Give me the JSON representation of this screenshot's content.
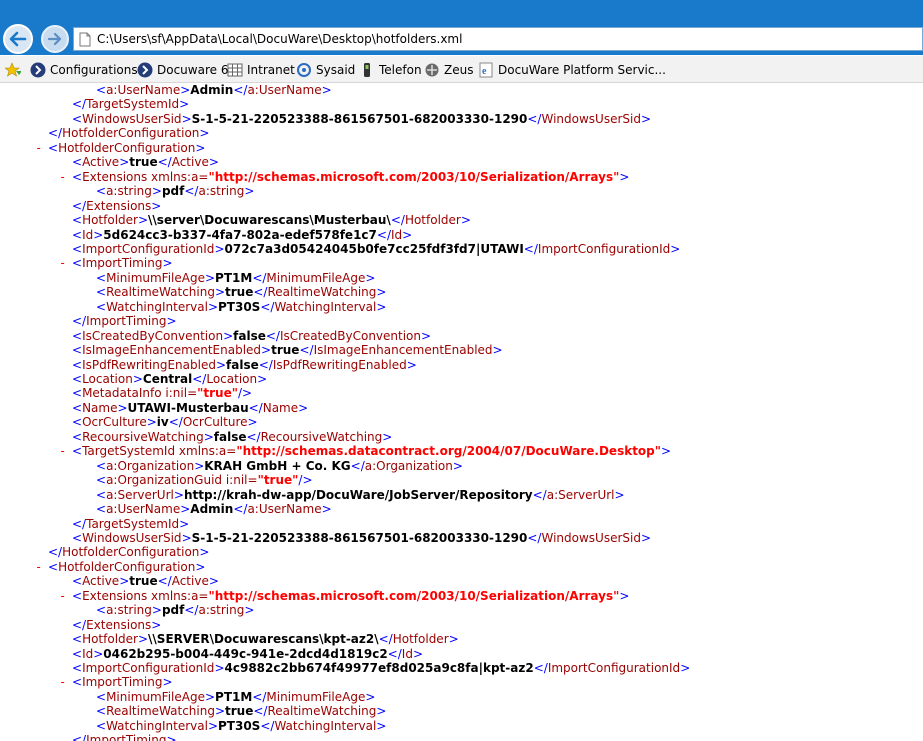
{
  "browser": {
    "address": "C:\\Users\\sf\\AppData\\Local\\DocuWare\\Desktop\\hotfolders.xml",
    "favorites": [
      "Configurations",
      "Docuware 6",
      "Intranet",
      "Sysaid",
      "Telefon",
      "Zeus",
      "DocuWare Platform Servic..."
    ]
  },
  "xml_lines": [
    {
      "i": 3,
      "m": "",
      "pre": "",
      "tag": "a:UserName",
      "val": "Admin",
      "close": "a:UserName"
    },
    {
      "i": 2,
      "m": "",
      "pre": "</",
      "tag": "TargetSystemId",
      "val": "",
      "close": ""
    },
    {
      "i": 2,
      "m": "",
      "pre": "",
      "tag": "WindowsUserSid",
      "val": "S-1-5-21-220523388-861567501-682003330-1290",
      "close": "WindowsUserSid"
    },
    {
      "i": 1,
      "m": "",
      "pre": "</",
      "tag": "HotfolderConfiguration",
      "val": "",
      "close": ""
    },
    {
      "i": 1,
      "m": "-",
      "pre": "",
      "tag": "HotfolderConfiguration",
      "val": "",
      "close": ""
    },
    {
      "i": 2,
      "m": "",
      "pre": "",
      "tag": "Active",
      "val": "true",
      "close": "Active"
    },
    {
      "i": 2,
      "m": "-",
      "pre": "",
      "tag": "Extensions",
      "attr": "xmlns:a",
      "attrval": "http://schemas.microsoft.com/2003/10/Serialization/Arrays",
      "val": "",
      "close": ""
    },
    {
      "i": 3,
      "m": "",
      "pre": "",
      "tag": "a:string",
      "val": "pdf",
      "close": "a:string"
    },
    {
      "i": 2,
      "m": "",
      "pre": "</",
      "tag": "Extensions",
      "val": "",
      "close": ""
    },
    {
      "i": 2,
      "m": "",
      "pre": "",
      "tag": "Hotfolder",
      "val": "\\\\server\\Docuwarescans\\Musterbau\\",
      "close": "Hotfolder"
    },
    {
      "i": 2,
      "m": "",
      "pre": "",
      "tag": "Id",
      "val": "5d624cc3-b337-4fa7-802a-edef578fe1c7",
      "close": "Id"
    },
    {
      "i": 2,
      "m": "",
      "pre": "",
      "tag": "ImportConfigurationId",
      "val": "072c7a3d05424045b0fe7cc25fdf3fd7|UTAWI",
      "close": "ImportConfigurationId"
    },
    {
      "i": 2,
      "m": "-",
      "pre": "",
      "tag": "ImportTiming",
      "val": "",
      "close": ""
    },
    {
      "i": 3,
      "m": "",
      "pre": "",
      "tag": "MinimumFileAge",
      "val": "PT1M",
      "close": "MinimumFileAge"
    },
    {
      "i": 3,
      "m": "",
      "pre": "",
      "tag": "RealtimeWatching",
      "val": "true",
      "close": "RealtimeWatching"
    },
    {
      "i": 3,
      "m": "",
      "pre": "",
      "tag": "WatchingInterval",
      "val": "PT30S",
      "close": "WatchingInterval"
    },
    {
      "i": 2,
      "m": "",
      "pre": "</",
      "tag": "ImportTiming",
      "val": "",
      "close": ""
    },
    {
      "i": 2,
      "m": "",
      "pre": "",
      "tag": "IsCreatedByConvention",
      "val": "false",
      "close": "IsCreatedByConvention"
    },
    {
      "i": 2,
      "m": "",
      "pre": "",
      "tag": "IsImageEnhancementEnabled",
      "val": "true",
      "close": "IsImageEnhancementEnabled"
    },
    {
      "i": 2,
      "m": "",
      "pre": "",
      "tag": "IsPdfRewritingEnabled",
      "val": "false",
      "close": "IsPdfRewritingEnabled"
    },
    {
      "i": 2,
      "m": "",
      "pre": "",
      "tag": "Location",
      "val": "Central",
      "close": "Location"
    },
    {
      "i": 2,
      "m": "",
      "pre": "",
      "tag": "MetadataInfo",
      "attr": "i:nil",
      "attrval": "true",
      "self": true,
      "val": "",
      "close": ""
    },
    {
      "i": 2,
      "m": "",
      "pre": "",
      "tag": "Name",
      "val": "UTAWI-Musterbau",
      "close": "Name"
    },
    {
      "i": 2,
      "m": "",
      "pre": "",
      "tag": "OcrCulture",
      "val": "iv",
      "close": "OcrCulture"
    },
    {
      "i": 2,
      "m": "",
      "pre": "",
      "tag": "RecoursiveWatching",
      "val": "false",
      "close": "RecoursiveWatching"
    },
    {
      "i": 2,
      "m": "-",
      "pre": "",
      "tag": "TargetSystemId",
      "attr": "xmlns:a",
      "attrval": "http://schemas.datacontract.org/2004/07/DocuWare.Desktop",
      "val": "",
      "close": ""
    },
    {
      "i": 3,
      "m": "",
      "pre": "",
      "tag": "a:Organization",
      "val": "KRAH GmbH + Co. KG",
      "close": "a:Organization"
    },
    {
      "i": 3,
      "m": "",
      "pre": "",
      "tag": "a:OrganizationGuid",
      "attr": "i:nil",
      "attrval": "true",
      "self": true,
      "val": "",
      "close": ""
    },
    {
      "i": 3,
      "m": "",
      "pre": "",
      "tag": "a:ServerUrl",
      "val": "http://krah-dw-app/DocuWare/JobServer/Repository",
      "close": "a:ServerUrl"
    },
    {
      "i": 3,
      "m": "",
      "pre": "",
      "tag": "a:UserName",
      "val": "Admin",
      "close": "a:UserName"
    },
    {
      "i": 2,
      "m": "",
      "pre": "</",
      "tag": "TargetSystemId",
      "val": "",
      "close": ""
    },
    {
      "i": 2,
      "m": "",
      "pre": "",
      "tag": "WindowsUserSid",
      "val": "S-1-5-21-220523388-861567501-682003330-1290",
      "close": "WindowsUserSid"
    },
    {
      "i": 1,
      "m": "",
      "pre": "</",
      "tag": "HotfolderConfiguration",
      "val": "",
      "close": ""
    },
    {
      "i": 1,
      "m": "-",
      "pre": "",
      "tag": "HotfolderConfiguration",
      "val": "",
      "close": ""
    },
    {
      "i": 2,
      "m": "",
      "pre": "",
      "tag": "Active",
      "val": "true",
      "close": "Active"
    },
    {
      "i": 2,
      "m": "-",
      "pre": "",
      "tag": "Extensions",
      "attr": "xmlns:a",
      "attrval": "http://schemas.microsoft.com/2003/10/Serialization/Arrays",
      "val": "",
      "close": ""
    },
    {
      "i": 3,
      "m": "",
      "pre": "",
      "tag": "a:string",
      "val": "pdf",
      "close": "a:string"
    },
    {
      "i": 2,
      "m": "",
      "pre": "</",
      "tag": "Extensions",
      "val": "",
      "close": ""
    },
    {
      "i": 2,
      "m": "",
      "pre": "",
      "tag": "Hotfolder",
      "val": "\\\\SERVER\\Docuwarescans\\kpt-az2\\",
      "close": "Hotfolder"
    },
    {
      "i": 2,
      "m": "",
      "pre": "",
      "tag": "Id",
      "val": "0462b295-b004-449c-941e-2dcd4d1819c2",
      "close": "Id"
    },
    {
      "i": 2,
      "m": "",
      "pre": "",
      "tag": "ImportConfigurationId",
      "val": "4c9882c2bb674f49977ef8d025a9c8fa|kpt-az2",
      "close": "ImportConfigurationId"
    },
    {
      "i": 2,
      "m": "-",
      "pre": "",
      "tag": "ImportTiming",
      "val": "",
      "close": ""
    },
    {
      "i": 3,
      "m": "",
      "pre": "",
      "tag": "MinimumFileAge",
      "val": "PT1M",
      "close": "MinimumFileAge"
    },
    {
      "i": 3,
      "m": "",
      "pre": "",
      "tag": "RealtimeWatching",
      "val": "true",
      "close": "RealtimeWatching"
    },
    {
      "i": 3,
      "m": "",
      "pre": "",
      "tag": "WatchingInterval",
      "val": "PT30S",
      "close": "WatchingInterval"
    },
    {
      "i": 2,
      "m": "",
      "pre": "</",
      "tag": "ImportTiming",
      "val": "",
      "close": ""
    }
  ]
}
